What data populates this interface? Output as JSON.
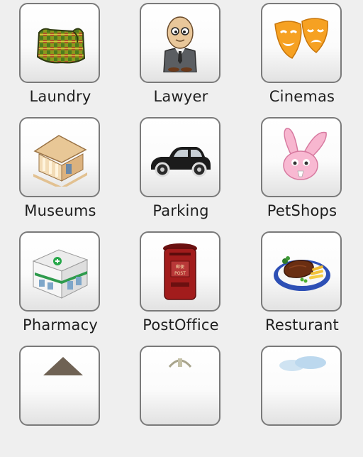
{
  "categories": [
    {
      "label": "Laundry",
      "icon": "laundry-bag-icon"
    },
    {
      "label": "Lawyer",
      "icon": "lawyer-icon"
    },
    {
      "label": "Cinemas",
      "icon": "theater-masks-icon"
    },
    {
      "label": "Museums",
      "icon": "museum-building-icon"
    },
    {
      "label": "Parking",
      "icon": "car-icon"
    },
    {
      "label": "PetShops",
      "icon": "bunny-icon"
    },
    {
      "label": "Pharmacy",
      "icon": "pharmacy-store-icon"
    },
    {
      "label": "PostOffice",
      "icon": "mailbox-icon"
    },
    {
      "label": "Resturant",
      "icon": "steak-plate-icon"
    },
    {
      "label": "",
      "icon": "house-icon"
    },
    {
      "label": "",
      "icon": "building-icon"
    },
    {
      "label": "",
      "icon": "landscape-icon"
    }
  ]
}
